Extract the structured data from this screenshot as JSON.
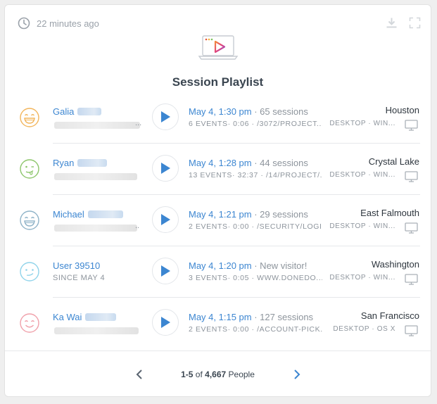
{
  "header": {
    "time": "22 minutes ago",
    "title": "Session Playlist"
  },
  "colors": {
    "link": "#3c86d1",
    "play": "#3c86d1",
    "muted": "#8d949c"
  },
  "sessions": [
    {
      "name": "Galia",
      "sub": "",
      "face_color": "#f2b55c",
      "face_icon": "laughing-face-icon",
      "date": "May 4, 1:30 pm",
      "count": "· 65 sessions",
      "detail": "6 EVENTS· 0:06 · /3072/PROJECT...",
      "city": "Houston",
      "device": "DESKTOP · WIN..."
    },
    {
      "name": "Ryan",
      "sub": "",
      "face_color": "#8cc56a",
      "face_icon": "tongue-face-icon",
      "date": "May 4, 1:28 pm",
      "count": "· 44 sessions",
      "detail": "13 EVENTS· 32:37 · /14/PROJECT/...",
      "city": "Crystal Lake",
      "device": "DESKTOP · WIN..."
    },
    {
      "name": "Michael",
      "sub": "",
      "face_color": "#8fb3c8",
      "face_icon": "grinning-face-icon",
      "date": "May 4, 1:21 pm",
      "count": "· 29 sessions",
      "detail": "2 EVENTS· 0:00 · /SECURITY/LOGIN",
      "city": "East Falmouth",
      "device": "DESKTOP · WIN..."
    },
    {
      "name": "User 39510",
      "sub": "SINCE MAY 4",
      "face_color": "#8fd3ea",
      "face_icon": "smirk-face-icon",
      "date": "May 4, 1:20 pm",
      "count": "· New visitor!",
      "detail": "3 EVENTS· 0:05 · WWW.DONEDO...",
      "city": "Washington",
      "device": "DESKTOP · WIN..."
    },
    {
      "name": "Ka Wai",
      "sub": "",
      "face_color": "#f0a0aa",
      "face_icon": "smiling-face-icon",
      "date": "May 4, 1:15 pm",
      "count": "· 127 sessions",
      "detail": "2 EVENTS· 0:00 · /ACCOUNT-PICK...",
      "city": "San Francisco",
      "device": "DESKTOP · OS X"
    }
  ],
  "pagination": {
    "range": "1-5",
    "of": "of",
    "total": "4,667",
    "unit": "People"
  }
}
